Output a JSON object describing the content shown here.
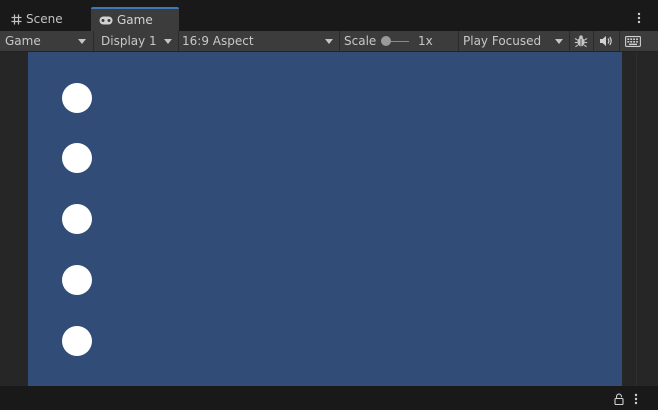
{
  "tabs": [
    {
      "label": "Scene",
      "icon": "grid-icon",
      "active": false
    },
    {
      "label": "Game",
      "icon": "gamepad-icon",
      "active": true
    }
  ],
  "toolbar": {
    "view_mode": "Game",
    "display": "Display 1",
    "aspect": "16:9 Aspect",
    "scale_label": "Scale",
    "scale_value": "1x",
    "play_mode": "Play Focused",
    "icons": [
      "bug-icon",
      "speaker-icon",
      "keyboard-icon"
    ]
  },
  "game_view": {
    "background_color": "#314d77",
    "dot_color": "#ffffff",
    "dot_count": 5
  },
  "colors": {
    "accent": "#3a79bb",
    "panel": "#3c3c3c",
    "background": "#191919"
  },
  "statusbar": {
    "icons": [
      "lock-icon",
      "more-vertical-icon"
    ]
  }
}
